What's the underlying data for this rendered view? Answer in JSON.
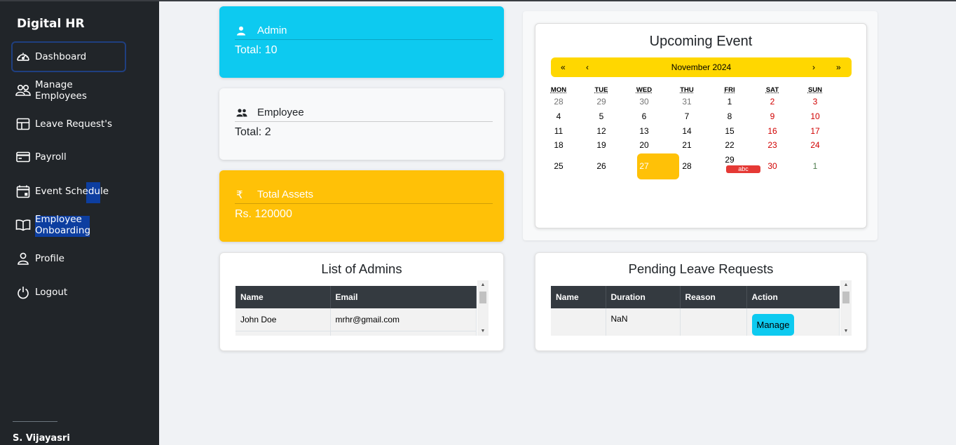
{
  "app": {
    "title": "Digital HR"
  },
  "sidebar": {
    "items": [
      {
        "label": "Dashboard",
        "icon": "speedometer-icon"
      },
      {
        "label": "Manage Employees",
        "icon": "people-icon"
      },
      {
        "label": "Leave Request's",
        "icon": "layout-icon"
      },
      {
        "label": "Payroll",
        "icon": "credit-card-icon"
      },
      {
        "label": "Event Schedule",
        "icon": "calendar-icon"
      },
      {
        "label": "Employee Onboarding",
        "icon": "book-icon"
      },
      {
        "label": "Profile",
        "icon": "person-icon"
      },
      {
        "label": "Logout",
        "icon": "power-icon"
      }
    ],
    "user": "S. Vijayasri"
  },
  "stats": {
    "admin": {
      "label": "Admin",
      "value": "Total: 10",
      "color": "#0dcaf0"
    },
    "employee": {
      "label": "Employee",
      "value": "Total: 2",
      "color": "#f8f9fa"
    },
    "assets": {
      "label": "Total Assets",
      "value": "Rs. 120000",
      "color": "#ffc107",
      "icon_glyph": "₹"
    }
  },
  "event": {
    "title": "Upcoming Event",
    "nav": {
      "prev_year": "«",
      "prev_month": "‹",
      "month": "November 2024",
      "next_month": "›",
      "next_year": "»"
    },
    "weekdays": [
      "MON",
      "TUE",
      "WED",
      "THU",
      "FRI",
      "SAT",
      "SUN"
    ],
    "weeks": [
      [
        "28",
        "29",
        "30",
        "31",
        "1",
        "2",
        "3"
      ],
      [
        "4",
        "5",
        "6",
        "7",
        "8",
        "9",
        "10"
      ],
      [
        "11",
        "12",
        "13",
        "14",
        "15",
        "16",
        "17"
      ],
      [
        "18",
        "19",
        "20",
        "21",
        "22",
        "23",
        "24"
      ],
      [
        "25",
        "26",
        "27",
        "28",
        "29",
        "30",
        "1"
      ]
    ],
    "today": "27",
    "event_label": "abc",
    "colors": {
      "nav": "#ffd700",
      "today": "#ffc107",
      "weekend": "#d10000",
      "event": "#e53935"
    }
  },
  "admins": {
    "title": "List of Admins",
    "columns": [
      "Name",
      "Email"
    ],
    "rows": [
      [
        "John Doe",
        "mrhr@gmail.com"
      ]
    ]
  },
  "leaves": {
    "title": "Pending Leave Requests",
    "columns": [
      "Name",
      "Duration",
      "Reason",
      "Action"
    ],
    "rows": [
      [
        "",
        "NaN",
        "",
        "Manage"
      ]
    ]
  }
}
